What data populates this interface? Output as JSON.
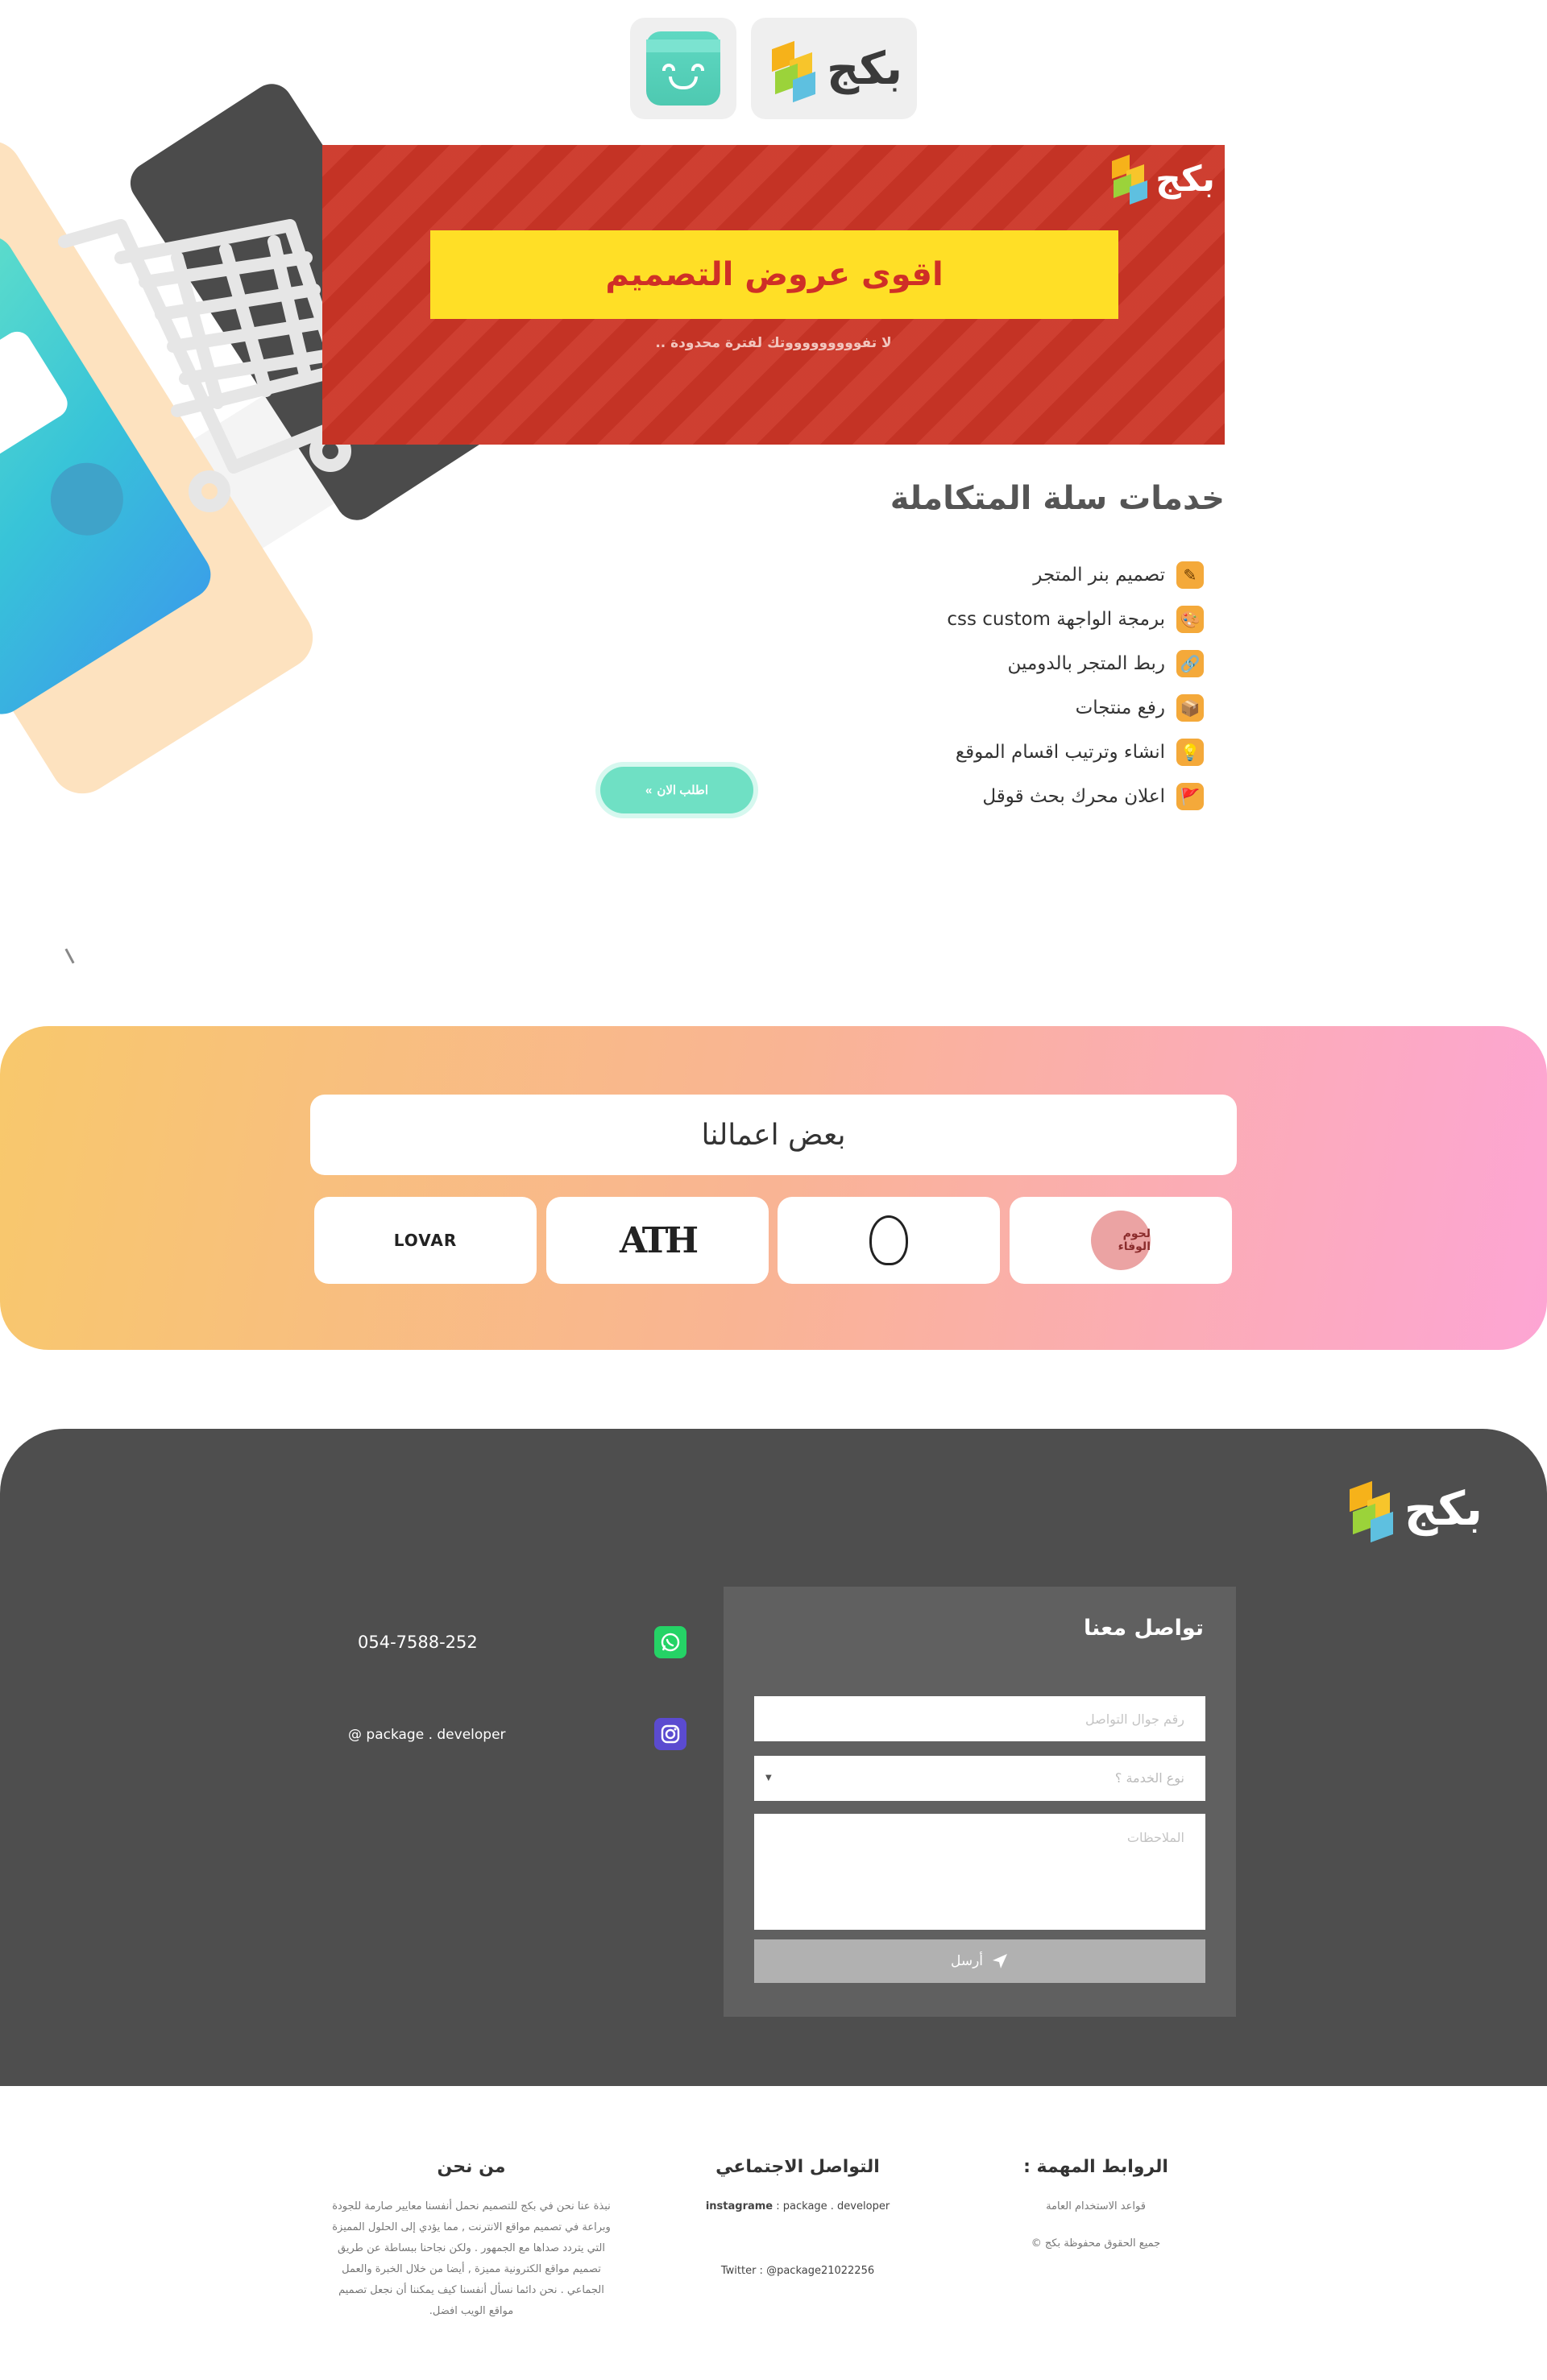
{
  "header": {
    "brand_name": "بكج",
    "smile_logo": "smile-box-icon"
  },
  "banner": {
    "brand_name": "بكج",
    "headline": "اقوى عروض التصميم",
    "subline": "لا تفوووووووووتك لفترة محدودة .."
  },
  "services": {
    "title": "خدمات سلة المتكاملة",
    "items": [
      {
        "label": "تصميم بنر المتجر",
        "icon": "pencil-icon",
        "glyph": "✎"
      },
      {
        "label": "برمجة الواجهة css custom",
        "icon": "palette-icon",
        "glyph": "🎨"
      },
      {
        "label": "ربط المتجر بالدومين",
        "icon": "link-icon",
        "glyph": "🔗"
      },
      {
        "label": "رفع منتجات",
        "icon": "box-icon",
        "glyph": "📦"
      },
      {
        "label": "انشاء وترتيب اقسام الموقع",
        "icon": "lightbulb-icon",
        "glyph": "💡"
      },
      {
        "label": "اعلان محرك بحث قوقل",
        "icon": "flag-icon",
        "glyph": "🚩"
      }
    ],
    "order_button": "اطلب الان"
  },
  "works": {
    "title": "بعض اعمالنا",
    "clients": [
      {
        "name": "LOVAR",
        "icon": "lovar-logo"
      },
      {
        "name": "ATH",
        "icon": "ath-logo"
      },
      {
        "name": "",
        "icon": "egg-logo"
      },
      {
        "name": "لحوم الوفاء",
        "icon": "coffee-logo"
      }
    ]
  },
  "contact": {
    "brand_name": "بكج",
    "phone": "054-7588-252",
    "instagram": "@ package . developer",
    "form": {
      "title": "تواصل معنا",
      "phone_placeholder": "رقم جوال التواصل",
      "service_placeholder": "نوع الخدمة ؟",
      "notes_placeholder": "الملاحظات",
      "send_label": "أرسل"
    }
  },
  "footer": {
    "links": {
      "title": "الروابط المهمة :",
      "items": [
        "قواعد الاستخدام العامة",
        "جميع الحقوق محفوظة بكج ©"
      ]
    },
    "social": {
      "title": "التواصل الاجتماعي",
      "instagram_label": "instagrame",
      "instagram_value": ": package . developer",
      "twitter": "Twitter : @package21022256"
    },
    "about": {
      "title": "من نحن",
      "lines": [
        "نبذة عنا نحن في بكج للتصميم نحمل أنفسنا معايير صارمة للجودة",
        "وبراعة في تصميم مواقع الانترنت , مما يؤدي إلى الحلول المميزة",
        "التي يتردد صداها مع الجمهور . ولكن نجاحنا ببساطة عن طريق",
        "تصميم مواقع الكترونية مميزة , أيضا من خلال الخبرة والعمل",
        "الجماعي . نحن دائما نسأل أنفسنا كيف يمكننا أن نجعل تصميم",
        "مواقع الويب افضل."
      ]
    }
  },
  "colors": {
    "banner_red": "#cc3526",
    "banner_yellow": "#ffdf26",
    "accent_teal": "#6fe0c4",
    "contact_bg": "#4e4e4e",
    "whatsapp_green": "#25d366",
    "instagram_purple": "#5b4bd0"
  }
}
